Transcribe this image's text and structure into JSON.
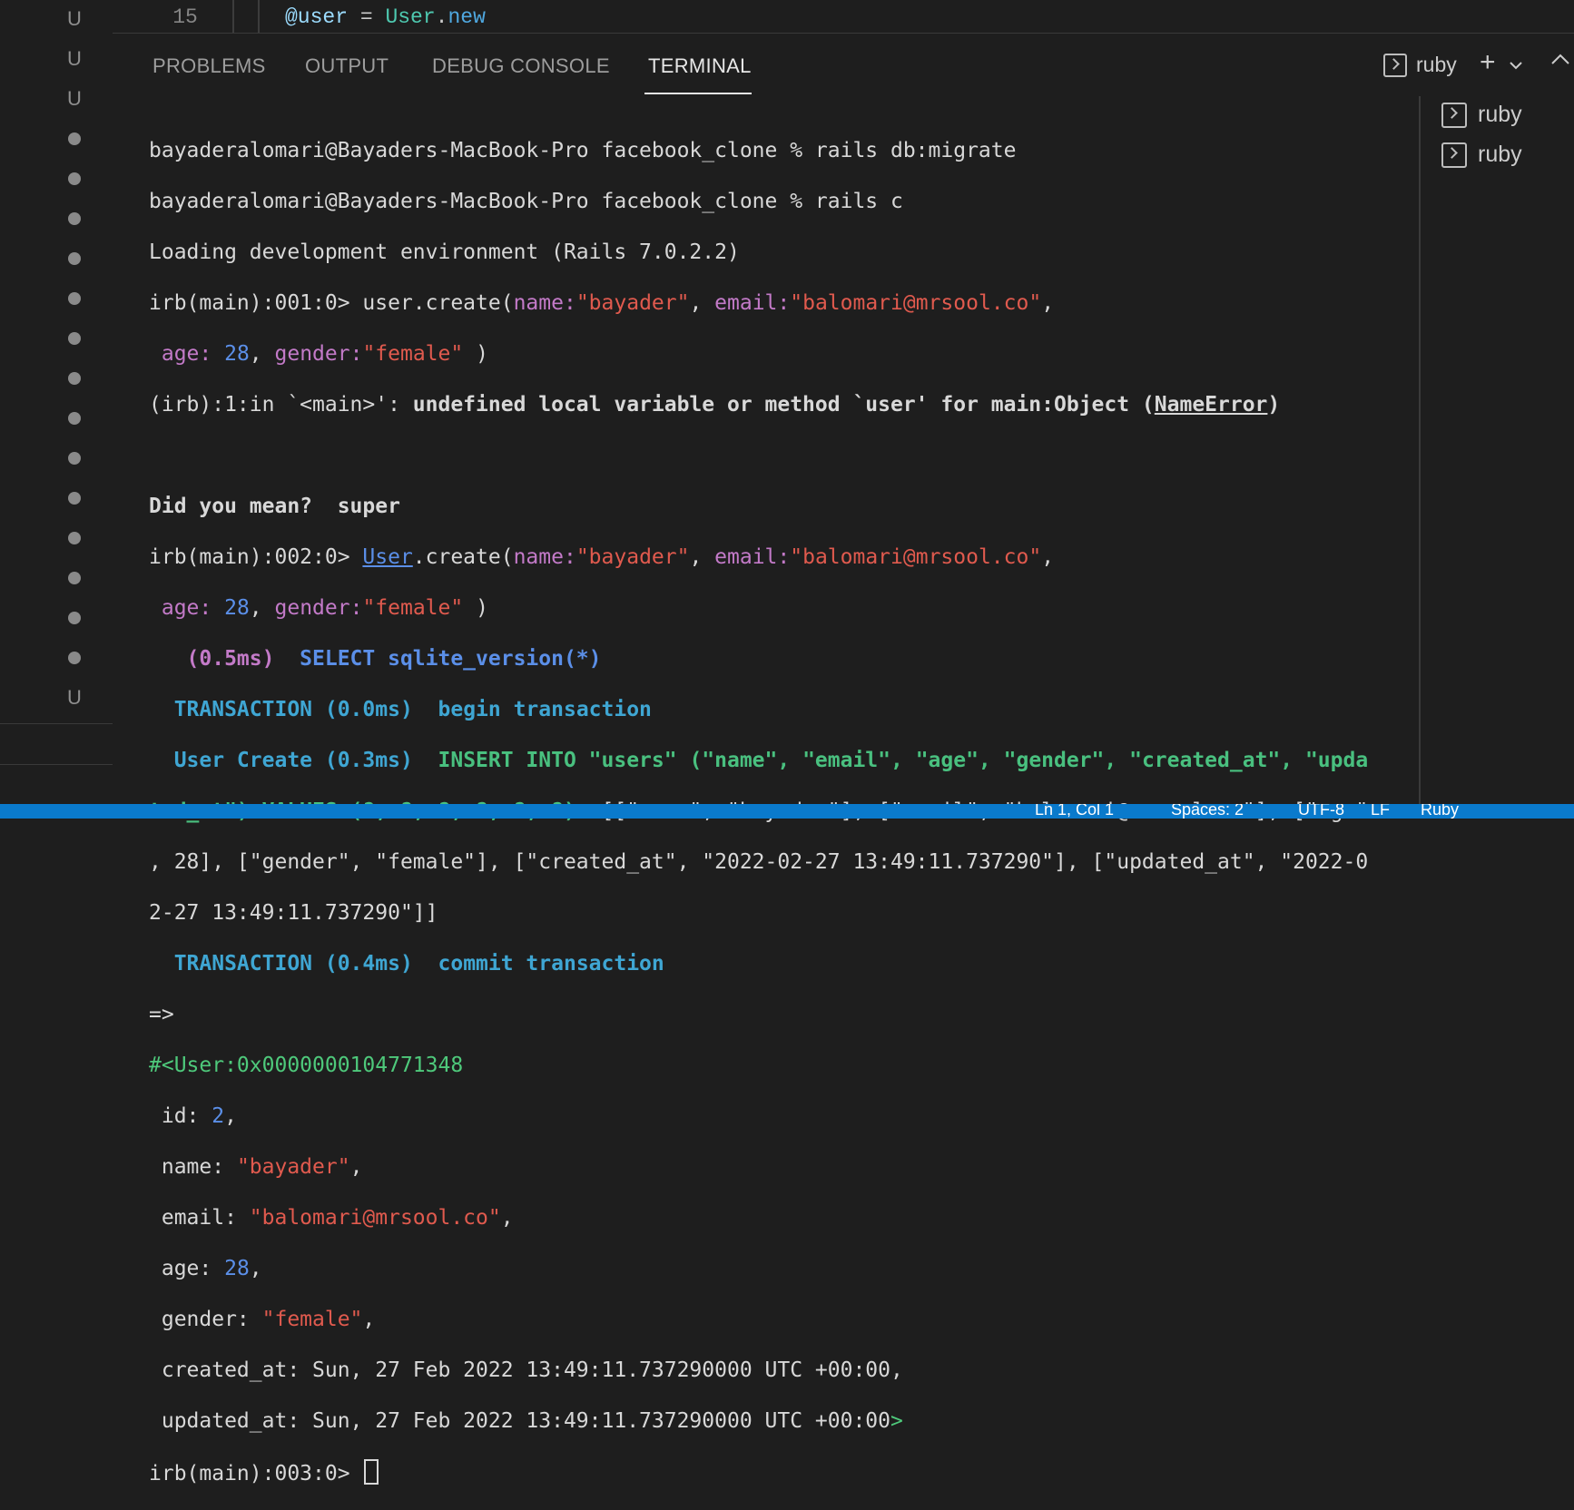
{
  "editor": {
    "line_number": "15",
    "code_var": "@user",
    "code_eq": " = ",
    "code_class": "User",
    "code_dot": ".",
    "code_method": "new"
  },
  "gutter": {
    "markers": [
      "U",
      "U",
      "U",
      "•",
      "•",
      "•",
      "•",
      "•",
      "•",
      "•",
      "•",
      "•",
      "•",
      "•",
      "•",
      "•",
      "•",
      "U"
    ]
  },
  "panel": {
    "tabs": [
      "PROBLEMS",
      "OUTPUT",
      "DEBUG CONSOLE",
      "TERMINAL"
    ],
    "active_tab": "TERMINAL",
    "terminal_name": "ruby",
    "terminal_list": [
      "ruby",
      "ruby"
    ]
  },
  "terminal": {
    "l1": "bayaderalomari@Bayaders-MacBook-Pro facebook_clone % rails db:migrate",
    "l2": "bayaderalomari@Bayaders-MacBook-Pro facebook_clone % rails c",
    "l3": "Loading development environment (Rails 7.0.2.2)",
    "l4_prompt": "irb(main):001:0> ",
    "l4_a": "user.create(",
    "k_name": "name:",
    "v_bayader": "\"bayader\"",
    "comma_sp": ", ",
    "k_email": "email:",
    "v_email": "\"balomari@mrsool.co\"",
    "comma": ",",
    "k_age": " age: ",
    "v_28": "28",
    "k_gender": "gender:",
    "v_female": "\"female\"",
    "close": " )",
    "err_a": "(irb):1:in `<main>': ",
    "err_b": "undefined local variable or method `user' for main:Object (",
    "err_c": "NameError",
    "err_d": ")",
    "dym": "Did you mean?  super",
    "l8_prompt": "irb(main):002:0> ",
    "l8_class": "User",
    "l8_rest": ".create(",
    "sql1_t": "   (0.5ms)  ",
    "sql1_q": "SELECT sqlite_version(*)",
    "sql2_t": "  TRANSACTION (0.0ms)  ",
    "sql2_q": "begin transaction",
    "sql3_t": "  User Create (0.3ms)  ",
    "sql3_q": "INSERT INTO \"users\" (\"name\", \"email\", \"age\", \"gender\", \"created_at\", \"upda",
    "sql3_q2": "ted_at\") VALUES (?, ?, ?, ?, ?, ?)",
    "sql3_p1": "  [[\"name\", \"bayader\"], [\"email\", \"balomari@mrsool.co\"], [\"age\"",
    "sql3_p2": ", 28], [\"gender\", \"female\"], [\"created_at\", \"2022-02-27 13:49:11.737290\"], [\"updated_at\", \"2022-0",
    "sql3_p3": "2-27 13:49:11.737290\"]]",
    "sql4_t": "  TRANSACTION (0.4ms)  ",
    "sql4_q": "commit transaction",
    "arrow": "=>",
    "obj": "#<User:0x0000000104771348",
    "id_k": " id: ",
    "id_v": "2",
    "name_k": " name: ",
    "name_v": "\"bayader\"",
    "email_k": " email: ",
    "email_v": "\"balomari@mrsool.co\"",
    "age_k": " age: ",
    "age_v": "28",
    "gender_k": " gender: ",
    "gender_v": "\"female\"",
    "created": " created_at: Sun, 27 Feb 2022 13:49:11.737290000 UTC +00:00,",
    "updated": " updated_at: Sun, 27 Feb 2022 13:49:11.737290000 UTC +00:00",
    "gt": ">",
    "last_prompt": "irb(main):003:0> "
  },
  "status_bar": {
    "position": "Ln 1, Col 1",
    "spaces": "Spaces: 2",
    "encoding": "UTF-8",
    "eol": "LF",
    "language": "Ruby"
  },
  "colors": {
    "background": "#1e1e1e",
    "status_bar": "#0a7acc",
    "string": "#e05a4e",
    "keyword_arg": "#c37ac8",
    "number": "#5b8fe8",
    "sql": "#49c07f"
  }
}
